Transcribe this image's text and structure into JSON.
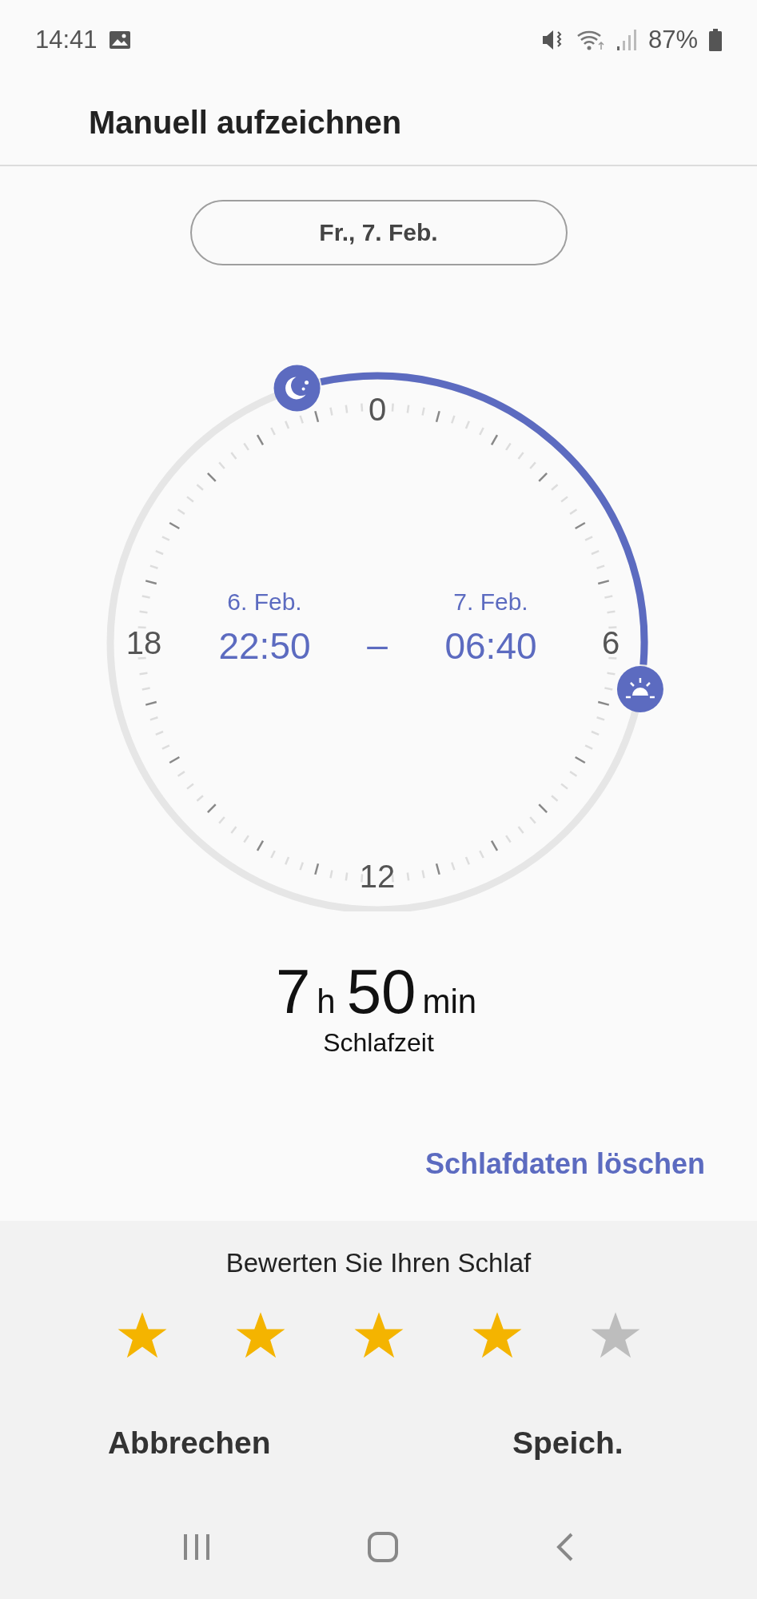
{
  "status_bar": {
    "time": "14:41",
    "battery": "87%"
  },
  "title": "Manuell aufzeichnen",
  "date_button": "Fr., 7. Feb.",
  "clock": {
    "hour_labels": [
      "0",
      "6",
      "12",
      "18"
    ],
    "start": {
      "date": "6. Feb.",
      "time": "22:50"
    },
    "separator": "–",
    "end": {
      "date": "7. Feb.",
      "time": "06:40"
    }
  },
  "duration": {
    "hours": "7",
    "hours_unit": "h",
    "minutes": "50",
    "minutes_unit": "min",
    "label": "Schlafzeit"
  },
  "delete_link": "Schlafdaten löschen",
  "rating": {
    "prompt": "Bewerten Sie Ihren Schlaf",
    "stars": 4
  },
  "buttons": [
    "Abbrechen",
    "Speich."
  ]
}
